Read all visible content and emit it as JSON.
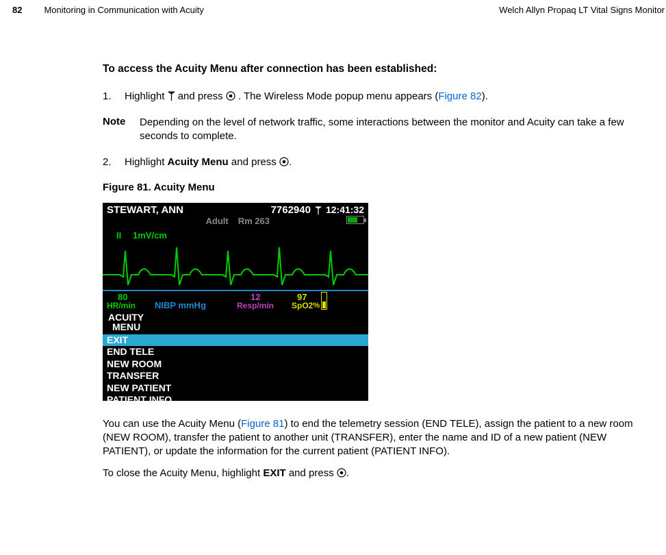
{
  "header": {
    "page_number": "82",
    "section_title": "Monitoring in Communication with Acuity",
    "product_name": "Welch Allyn Propaq LT Vital Signs Monitor"
  },
  "heading": "To access the Acuity Menu after connection has been established:",
  "step1": {
    "num": "1.",
    "pre": "Highlight ",
    "mid": " and press ",
    "post": ". The Wireless Mode popup menu appears (",
    "link": "Figure 82",
    "close": ")."
  },
  "note": {
    "label": "Note",
    "text": "Depending on the level of network traffic, some interactions between the monitor and Acuity can take a few seconds to complete."
  },
  "step2": {
    "num": "2.",
    "pre": "Highlight ",
    "bold": "Acuity Menu",
    "mid": " and press ",
    "post": "."
  },
  "figure_caption": "Figure 81.  Acuity Menu",
  "monitor": {
    "patient_name": "STEWART, ANN",
    "patient_id": "7762940",
    "patient_mode": "Adult",
    "room": "Rm 263",
    "time": "12:41:32",
    "lead": "II",
    "scale": "1mV/cm",
    "hr_value": "80",
    "hr_label": "HR/min",
    "nibp_label": "NIBP mmHg",
    "resp_value": "12",
    "resp_label": "Resp/min",
    "spo2_value": "97",
    "spo2_label": "SpO2",
    "menu_title_1": "ACUITY",
    "menu_title_2": "MENU",
    "menu_items": [
      "EXIT",
      "END TELE",
      "NEW ROOM",
      "TRANSFER",
      "NEW PATIENT",
      "PATIENT INFO"
    ],
    "selected_index": 0
  },
  "para1": {
    "pre": "You can use the Acuity Menu (",
    "link": "Figure 81",
    "post": ") to end the telemetry session (END TELE), assign the patient to a new room (NEW ROOM), transfer the patient to another unit (TRANSFER), enter the name and ID of a new patient (NEW PATIENT), or update the information for the current patient (PATIENT INFO)."
  },
  "para2": {
    "pre": "To close the Acuity Menu, highlight ",
    "bold": "EXIT",
    "mid": " and press ",
    "post": "."
  }
}
